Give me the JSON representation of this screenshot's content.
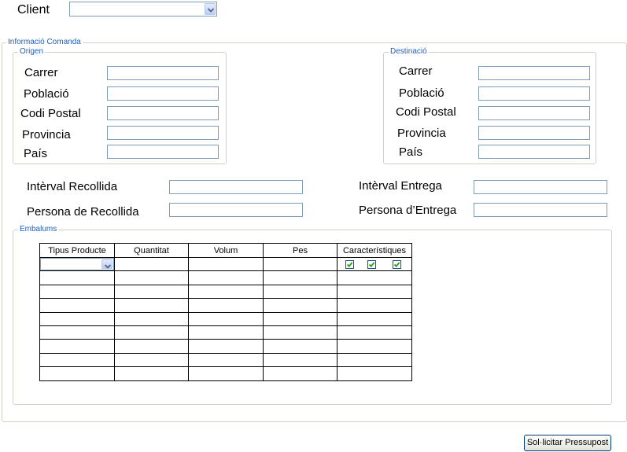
{
  "client": {
    "label": "Client",
    "value": ""
  },
  "order_info": {
    "legend": "Informació Comanda",
    "origin": {
      "legend": "Origen",
      "fields": [
        {
          "label": "Carrer",
          "value": ""
        },
        {
          "label": "Població",
          "value": ""
        },
        {
          "label": "Codi Postal",
          "value": ""
        },
        {
          "label": "Provincia",
          "value": ""
        },
        {
          "label": "País",
          "value": ""
        }
      ]
    },
    "destination": {
      "legend": "Destinació",
      "fields": [
        {
          "label": "Carrer",
          "value": ""
        },
        {
          "label": "Població",
          "value": ""
        },
        {
          "label": "Codi Postal",
          "value": ""
        },
        {
          "label": "Provincia",
          "value": ""
        },
        {
          "label": "País",
          "value": ""
        }
      ]
    },
    "pickup_interval": {
      "label": "Intèrval Recollida",
      "value": ""
    },
    "pickup_person": {
      "label": "Persona de Recollida",
      "value": ""
    },
    "delivery_interval": {
      "label": "Intèrval Entrega",
      "value": ""
    },
    "delivery_person": {
      "label": "Persona d’Entrega",
      "value": ""
    }
  },
  "packages": {
    "legend": "Embalums",
    "columns": [
      "Tipus Producte",
      "Quantitat",
      "Volum",
      "Pes",
      "Característiques"
    ],
    "row_count": 9,
    "features_checked": [
      true,
      true,
      true
    ]
  },
  "submit_label": "Sol·licitar Pressupost",
  "colors": {
    "legend": "#1f5fc0",
    "input_border": "#7f9db9",
    "checkmark": "#21a121"
  }
}
